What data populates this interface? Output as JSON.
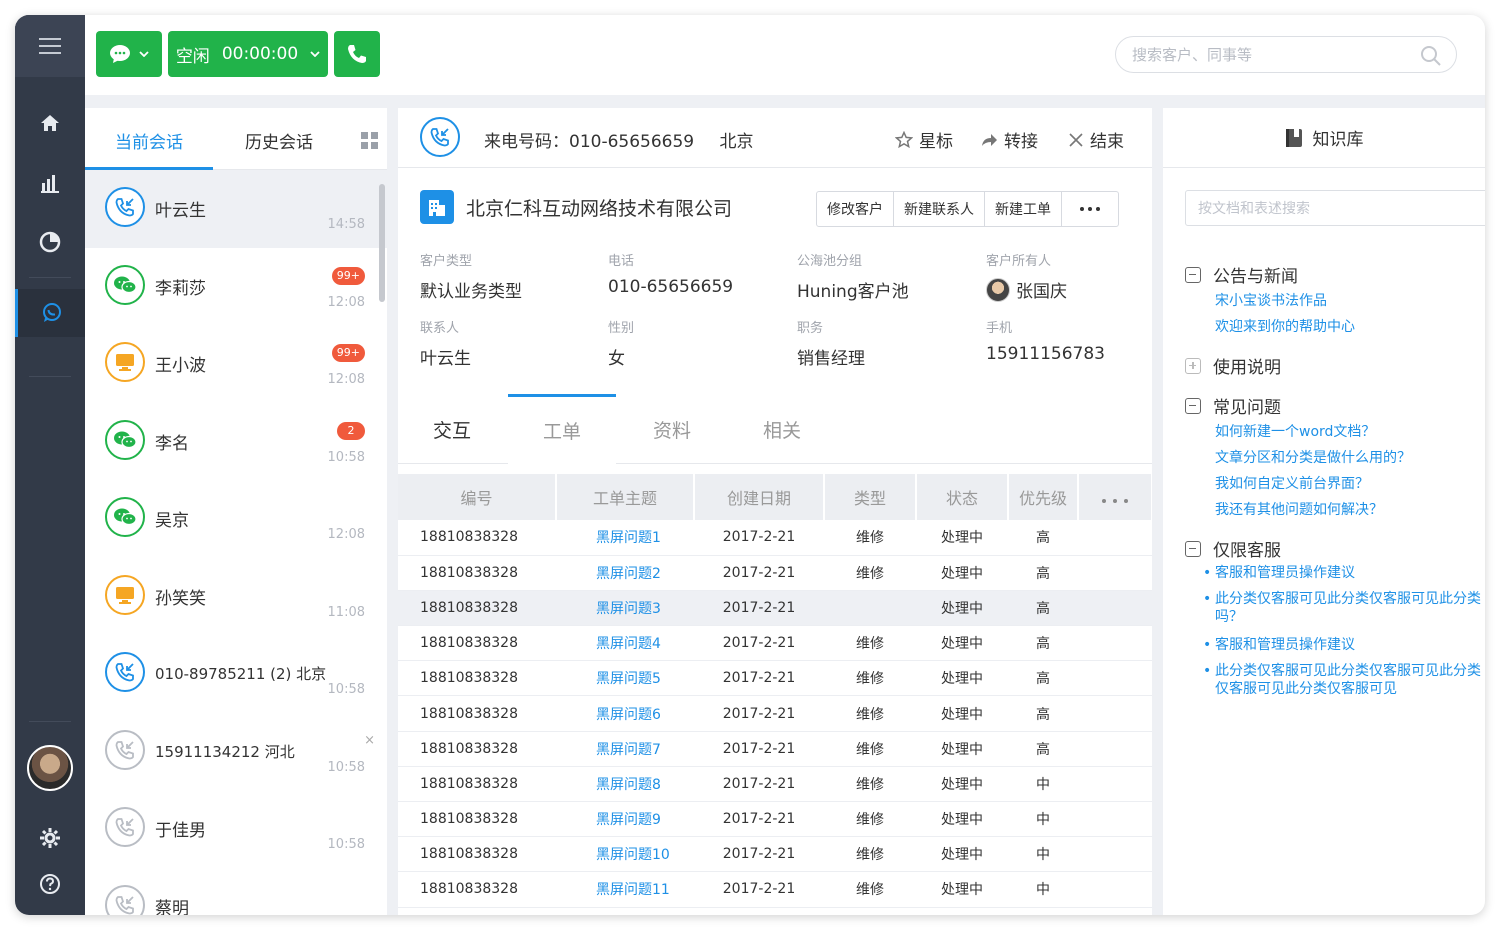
{
  "topbar": {
    "status_label": "空闲",
    "timer": "00:00:00",
    "search_placeholder": "搜索客户、同事等"
  },
  "conversations": {
    "tab_current": "当前会话",
    "tab_history": "历史会话",
    "items": [
      {
        "name": "叶云生",
        "time": "14:58",
        "badge": "",
        "icon": "phone-incoming-icon",
        "color": "#1e90e6"
      },
      {
        "name": "李莉莎",
        "time": "12:08",
        "badge": "99+",
        "icon": "wechat-icon",
        "color": "#21b34a"
      },
      {
        "name": "王小波",
        "time": "12:08",
        "badge": "99+",
        "icon": "monitor-icon",
        "color": "#f5a623"
      },
      {
        "name": "李名",
        "time": "10:58",
        "badge": "2",
        "icon": "wechat-icon",
        "color": "#21b34a"
      },
      {
        "name": "吴京",
        "time": "12:08",
        "badge": "",
        "icon": "wechat-icon",
        "color": "#21b34a"
      },
      {
        "name": "孙笑笑",
        "time": "11:08",
        "badge": "",
        "icon": "monitor-icon",
        "color": "#f5a623"
      },
      {
        "name": "010-89785211 (2) 北京",
        "time": "10:58",
        "badge": "",
        "icon": "phone-incoming-icon",
        "color": "#1e90e6"
      },
      {
        "name": "15911134212  河北",
        "time": "10:58",
        "badge": "",
        "icon": "phone-incoming-icon",
        "color": "#b9bdc4",
        "close": "×"
      },
      {
        "name": "于佳男",
        "time": "10:58",
        "badge": "",
        "icon": "phone-incoming-icon",
        "color": "#b9bdc4"
      },
      {
        "name": "蔡明",
        "time": "",
        "badge": "",
        "icon": "phone-incoming-icon",
        "color": "#b9bdc4"
      }
    ]
  },
  "call": {
    "label": "来电号码：010-65656659",
    "location": "北京",
    "star": "星标",
    "transfer": "转接",
    "end": "结束"
  },
  "customer": {
    "company": "北京仁科互动网络技术有限公司",
    "actions": [
      "修改客户",
      "新建联系人",
      "新建工单"
    ],
    "fields": [
      {
        "label": "客户类型",
        "value": "默认业务类型"
      },
      {
        "label": "电话",
        "value": "010-65656659"
      },
      {
        "label": "公海池分组",
        "value": "Huning客户池"
      },
      {
        "label": "客户所有人",
        "value": "张国庆"
      },
      {
        "label": "联系人",
        "value": "叶云生"
      },
      {
        "label": "性别",
        "value": "女"
      },
      {
        "label": "职务",
        "value": "销售经理"
      },
      {
        "label": "手机",
        "value": "15911156783"
      }
    ]
  },
  "detail_tabs": [
    "交互",
    "工单",
    "资料",
    "相关"
  ],
  "tickets": {
    "columns": [
      "编号",
      "工单主题",
      "创建日期",
      "类型",
      "状态",
      "优先级"
    ],
    "rows": [
      [
        "18810838328",
        "黑屏问题1",
        "2017-2-21",
        "维修",
        "处理中",
        "高"
      ],
      [
        "18810838328",
        "黑屏问题2",
        "2017-2-21",
        "维修",
        "处理中",
        "高"
      ],
      [
        "18810838328",
        "黑屏问题3",
        "2017-2-21",
        "",
        "处理中",
        "高"
      ],
      [
        "18810838328",
        "黑屏问题4",
        "2017-2-21",
        "维修",
        "处理中",
        "高"
      ],
      [
        "18810838328",
        "黑屏问题5",
        "2017-2-21",
        "维修",
        "处理中",
        "高"
      ],
      [
        "18810838328",
        "黑屏问题6",
        "2017-2-21",
        "维修",
        "处理中",
        "高"
      ],
      [
        "18810838328",
        "黑屏问题7",
        "2017-2-21",
        "维修",
        "处理中",
        "高"
      ],
      [
        "18810838328",
        "黑屏问题8",
        "2017-2-21",
        "维修",
        "处理中",
        "中"
      ],
      [
        "18810838328",
        "黑屏问题9",
        "2017-2-21",
        "维修",
        "处理中",
        "中"
      ],
      [
        "18810838328",
        "黑屏问题10",
        "2017-2-21",
        "维修",
        "处理中",
        "中"
      ],
      [
        "18810838328",
        "黑屏问题11",
        "2017-2-21",
        "维修",
        "处理中",
        "中"
      ]
    ]
  },
  "knowledge": {
    "title": "知识库",
    "search_placeholder": "按文档和表述搜索",
    "sections": [
      {
        "title": "公告与新闻",
        "links": [
          "宋小宝谈书法作品",
          "欢迎来到你的帮助中心"
        ]
      },
      {
        "title": "使用说明",
        "links": []
      },
      {
        "title": "常见问题",
        "links": [
          "如何新建一个word文档？",
          "文章分区和分类是做什么用的？",
          "我如何自定义前台界面？",
          "我还有其他问题如何解决？"
        ]
      },
      {
        "title": "仅限客服",
        "links": [
          "客服和管理员操作建议",
          "此分类仅客服可见此分类仅客服可见此分类吗？",
          "客服和管理员操作建议",
          "此分类仅客服可见此分类仅客服可见此分类仅客服可见此分类仅客服可见"
        ]
      }
    ]
  },
  "colors": {
    "accent": "#1e90e6",
    "green": "#21b34a",
    "sidebar": "#323a48"
  }
}
